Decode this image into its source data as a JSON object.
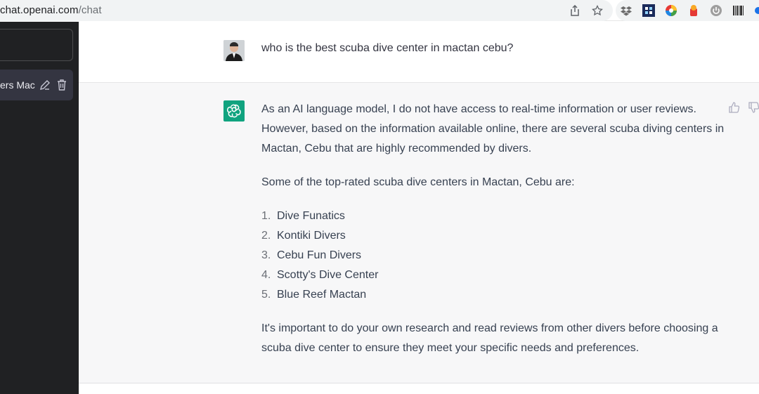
{
  "browser": {
    "url_host": "chat.openai.com",
    "url_path": "/chat"
  },
  "sidebar": {
    "conversation_label": "ers Mac"
  },
  "chat": {
    "user_message": "who is the best scuba dive center in mactan cebu?",
    "assistant": {
      "intro": "As an AI language model, I do not have access to real-time information or user reviews. However, based on the information available online, there are several scuba diving centers in Mactan, Cebu that are highly recommended by divers.",
      "list_heading": "Some of the top-rated scuba dive centers in Mactan, Cebu are:",
      "items": [
        {
          "num": "1.",
          "text": "Dive Funatics"
        },
        {
          "num": "2.",
          "text": "Kontiki Divers"
        },
        {
          "num": "3.",
          "text": "Cebu Fun Divers"
        },
        {
          "num": "4.",
          "text": "Scotty's Dive Center"
        },
        {
          "num": "5.",
          "text": "Blue Reef Mactan"
        }
      ],
      "closing": "It's important to do your own research and read reviews from other divers before choosing a scuba dive center to ensure they meet your specific needs and preferences."
    }
  },
  "colors": {
    "sidebar_bg": "#202123",
    "accent": "#10a37f",
    "assistant_bg": "#f7f7f8"
  },
  "icons": [
    "share-icon",
    "bookmark-star-icon",
    "edit-icon",
    "trash-icon",
    "thumbs-up-icon",
    "thumbs-down-icon",
    "openai-logo-icon"
  ]
}
